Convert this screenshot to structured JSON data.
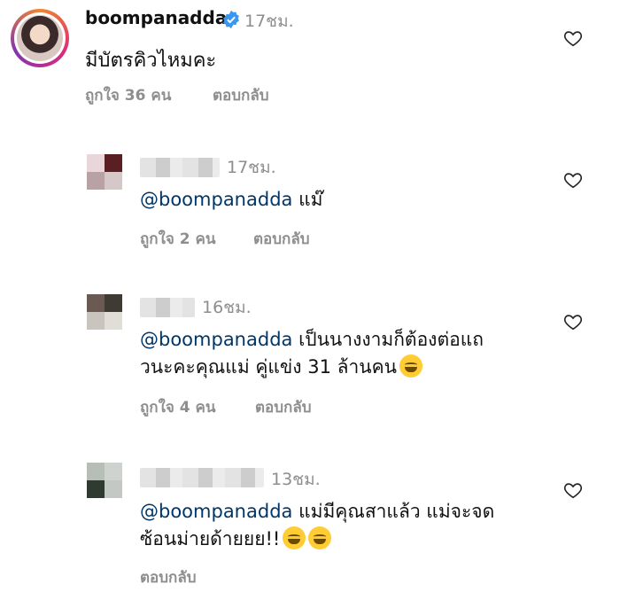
{
  "main_comment": {
    "username": "boompanadda",
    "time": "17ชม.",
    "text": "มีบัตรคิวไหมคะ",
    "likes": "ถูกใจ 36 คน",
    "reply": "ตอบกลับ"
  },
  "replies": [
    {
      "time": "17ชม.",
      "mention": "@boompanadda",
      "text": " แม๊",
      "likes": "ถูกใจ 2 คน",
      "reply": "ตอบกลับ",
      "avatar_colors": [
        "#e8d6da",
        "#5a1f22",
        "#b8a2a5",
        "#d6c7c9"
      ]
    },
    {
      "time": "16ชม.",
      "mention": "@boompanadda",
      "text_line1": " เป็นนางงามก็ต้องต่อแถ",
      "text_line2": "วนะคะคุณแม่ คู่แข่ง 31 ล้านคน",
      "emoji": "grinning-sweat-emoji",
      "likes": "ถูกใจ 4 คน",
      "reply": "ตอบกลับ",
      "avatar_colors": [
        "#6b5a52",
        "#3f3a33",
        "#c9c4bd",
        "#e1ddd7"
      ]
    },
    {
      "time": "13ชม.",
      "mention": "@boompanadda",
      "text_line1": " แม่มีคุณสาแล้ว แม่จะจด",
      "text_line2": "ซ้อนม่ายด้ายยย!!",
      "emoji": "tears-of-joy-emoji",
      "reply": "ตอบกลับ",
      "avatar_colors": [
        "#b7bdb7",
        "#cfd3cf",
        "#2f3a30",
        "#c4c8c4"
      ]
    }
  ],
  "colors": {
    "muted": "#8e8e8e",
    "mention": "#00376b",
    "verified": "#3897f0"
  }
}
